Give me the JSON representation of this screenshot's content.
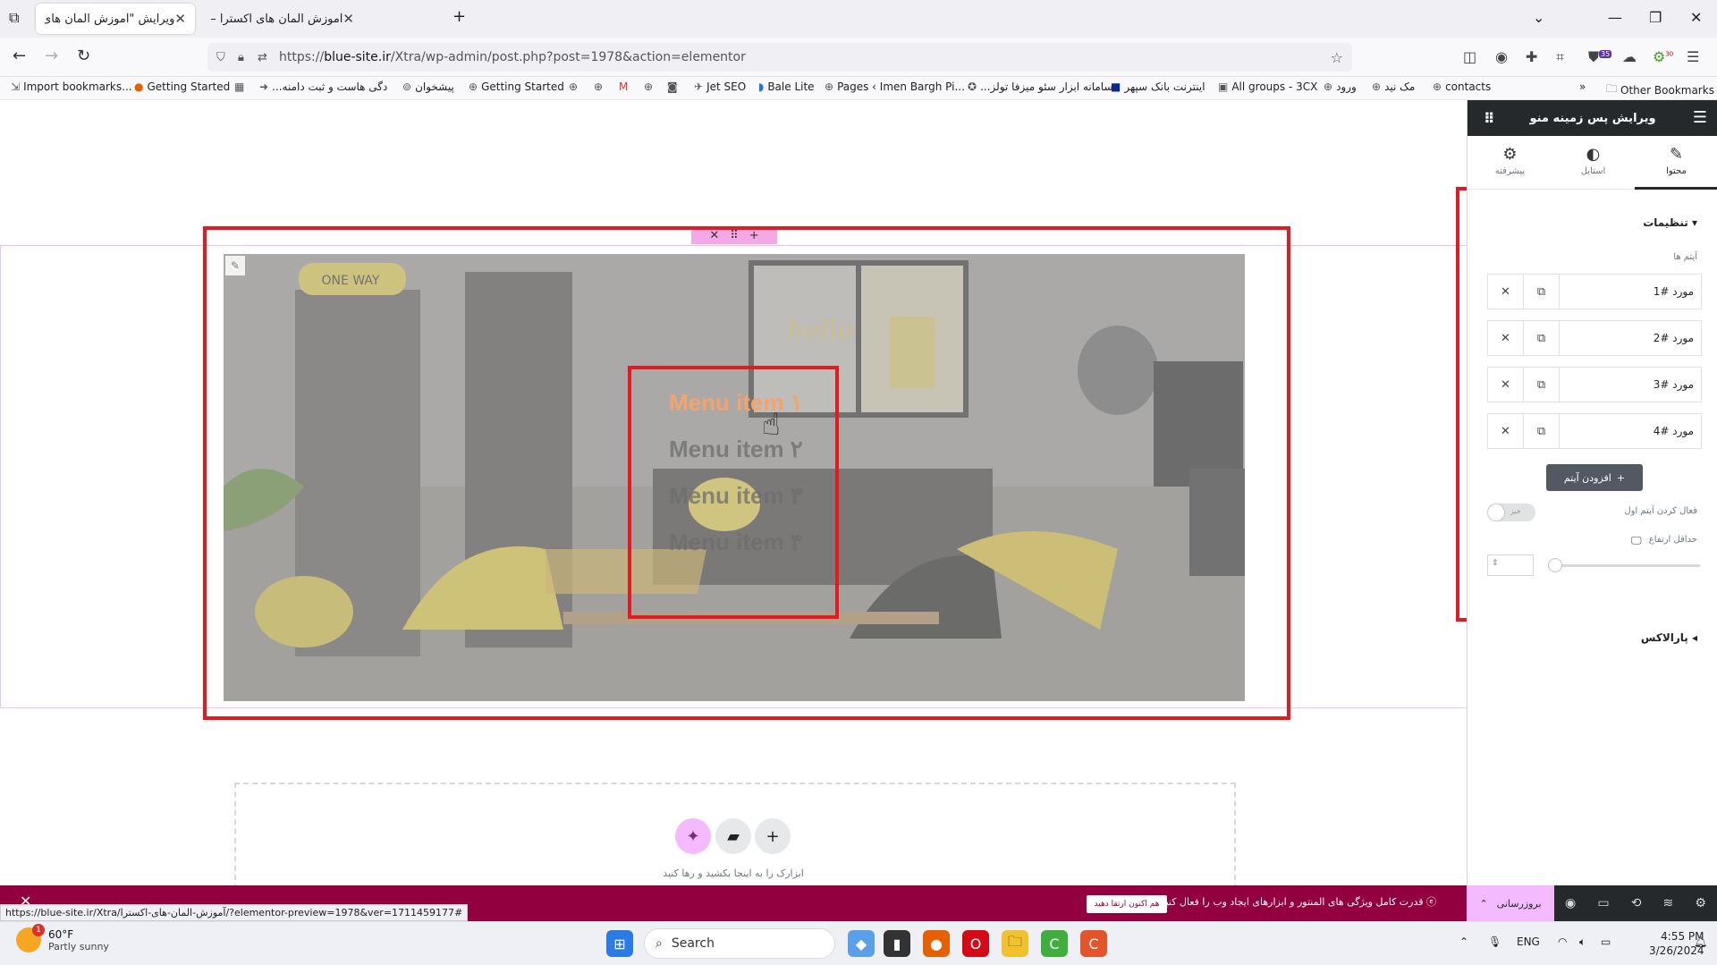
{
  "tabs": [
    {
      "title": "ویرایش \"آموزش المان های اکسترا – ع",
      "active": true
    },
    {
      "title": "آموزش المان های اکسترا – علاءالدین",
      "active": false
    }
  ],
  "address": {
    "scheme": "https://",
    "host": "blue-site.ir",
    "path": "/Xtra/wp-admin/post.php?post=1978&action=elementor"
  },
  "toolbar": {
    "extension_badge": "35",
    "extension_badge2": "30"
  },
  "bookmarks": [
    "Import bookmarks...",
    "Getting Started",
    "...دگی هاست و ثبت دامنه",
    "پیشخوان",
    "Getting Started",
    "Jet SEO",
    "Bale Lite",
    "Pages ‹ Imen Bargh Pi...",
    "...سامانه ابزار سئو میزفا تولز",
    "اینترنت بانک سپهر",
    "All groups - 3CX",
    "ورود",
    "مک نید",
    "contacts",
    "Other Bookmarks"
  ],
  "canvas": {
    "scene_text": "ONE WAY",
    "scene_text2": "hello",
    "menu_items": [
      "Menu item ۱",
      "Menu item ۲",
      "Menu item ۳",
      "Menu item ۴"
    ],
    "dropzone_text": "ابزارک را به اینجا بکشید و رها کنید"
  },
  "panel": {
    "title": "ویرایش پس زمینه منو",
    "tabs": [
      "محتوا",
      "استایل",
      "پیشرفته"
    ],
    "section_settings": "تنظیمات",
    "items_label": "آیتم ها",
    "items": [
      "مورد #1",
      "مورد #2",
      "مورد #3",
      "مورد #4"
    ],
    "add_item": "افزودن آیتم",
    "activate_first_label": "فعال کردن آیتم اول",
    "toggle_text": "خیر",
    "min_height_label": "حداقل ارتفاع",
    "section_parallax": "پارالاکس"
  },
  "bottombar": {
    "promo": "قدرت کامل ویژگی های المنتور و ابزارهای ایجاد وب را فعال کنید.",
    "promo_button": "هم اکنون ارتقا دهید",
    "update": "بروزرسانی",
    "status_url": "https://blue-site.ir/Xtra/آموزش-المان-های-اکسترا/?elementor-preview=1978&ver=1711459177#"
  },
  "taskbar": {
    "temp": "60°F",
    "weather": "Partly sunny",
    "weather_badge": "1",
    "search": "Search",
    "lang": "ENG",
    "time": "4:55 PM",
    "date": "3/26/2024"
  },
  "colors": {
    "accent_red": "#e11b22",
    "elementor_dark": "#26292c",
    "promo_bar": "#93003f",
    "update_pink": "#f3bafd"
  }
}
